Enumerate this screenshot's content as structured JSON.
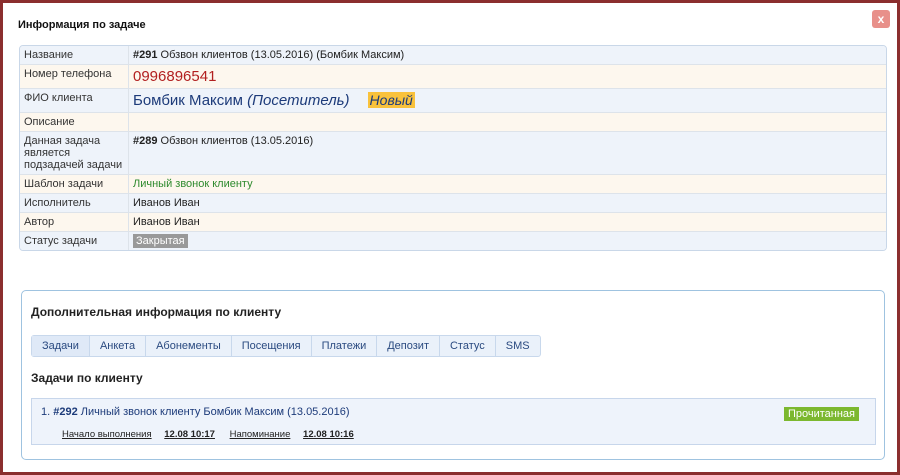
{
  "dialog": {
    "title": "Информация по задаче",
    "close_label": "x"
  },
  "info": {
    "name_label": "Название",
    "name_num": "#291",
    "name_text": " Обзвон клиентов (13.05.2016) (Бомбик Максим)",
    "phone_label": "Номер телефона",
    "phone_value": "0996896541",
    "fio_label": "ФИО клиента",
    "fio_name": "Бомбик Максим",
    "fio_role": "(Посетитель)",
    "fio_badge": "Новый",
    "desc_label": "Описание",
    "desc_value": "",
    "parent_label": "Данная задача является подзадачей задачи",
    "parent_num": "#289",
    "parent_text": " Обзвон клиентов (13.05.2016)",
    "template_label": "Шаблон задачи",
    "template_value": "Личный звонок клиенту",
    "executor_label": "Исполнитель",
    "executor_value": "Иванов Иван",
    "author_label": "Автор",
    "author_value": "Иванов Иван",
    "status_label": "Статус задачи",
    "status_value": "Закрытая"
  },
  "extra": {
    "title": "Дополнительная информация по клиенту",
    "tabs": [
      "Задачи",
      "Анкета",
      "Абонементы",
      "Посещения",
      "Платежи",
      "Депозит",
      "Статус",
      "SMS"
    ],
    "tasks_title": "Задачи по клиенту",
    "task": {
      "index": "1.",
      "num": "#292",
      "text": " Личный звонок клиенту Бомбик Максим (13.05.2016)",
      "status": "Прочитанная",
      "start_label": "Начало выполнения",
      "start_value": "12.08 10:17",
      "remind_label": "Напоминание",
      "remind_value": "12.08 10:16"
    }
  }
}
